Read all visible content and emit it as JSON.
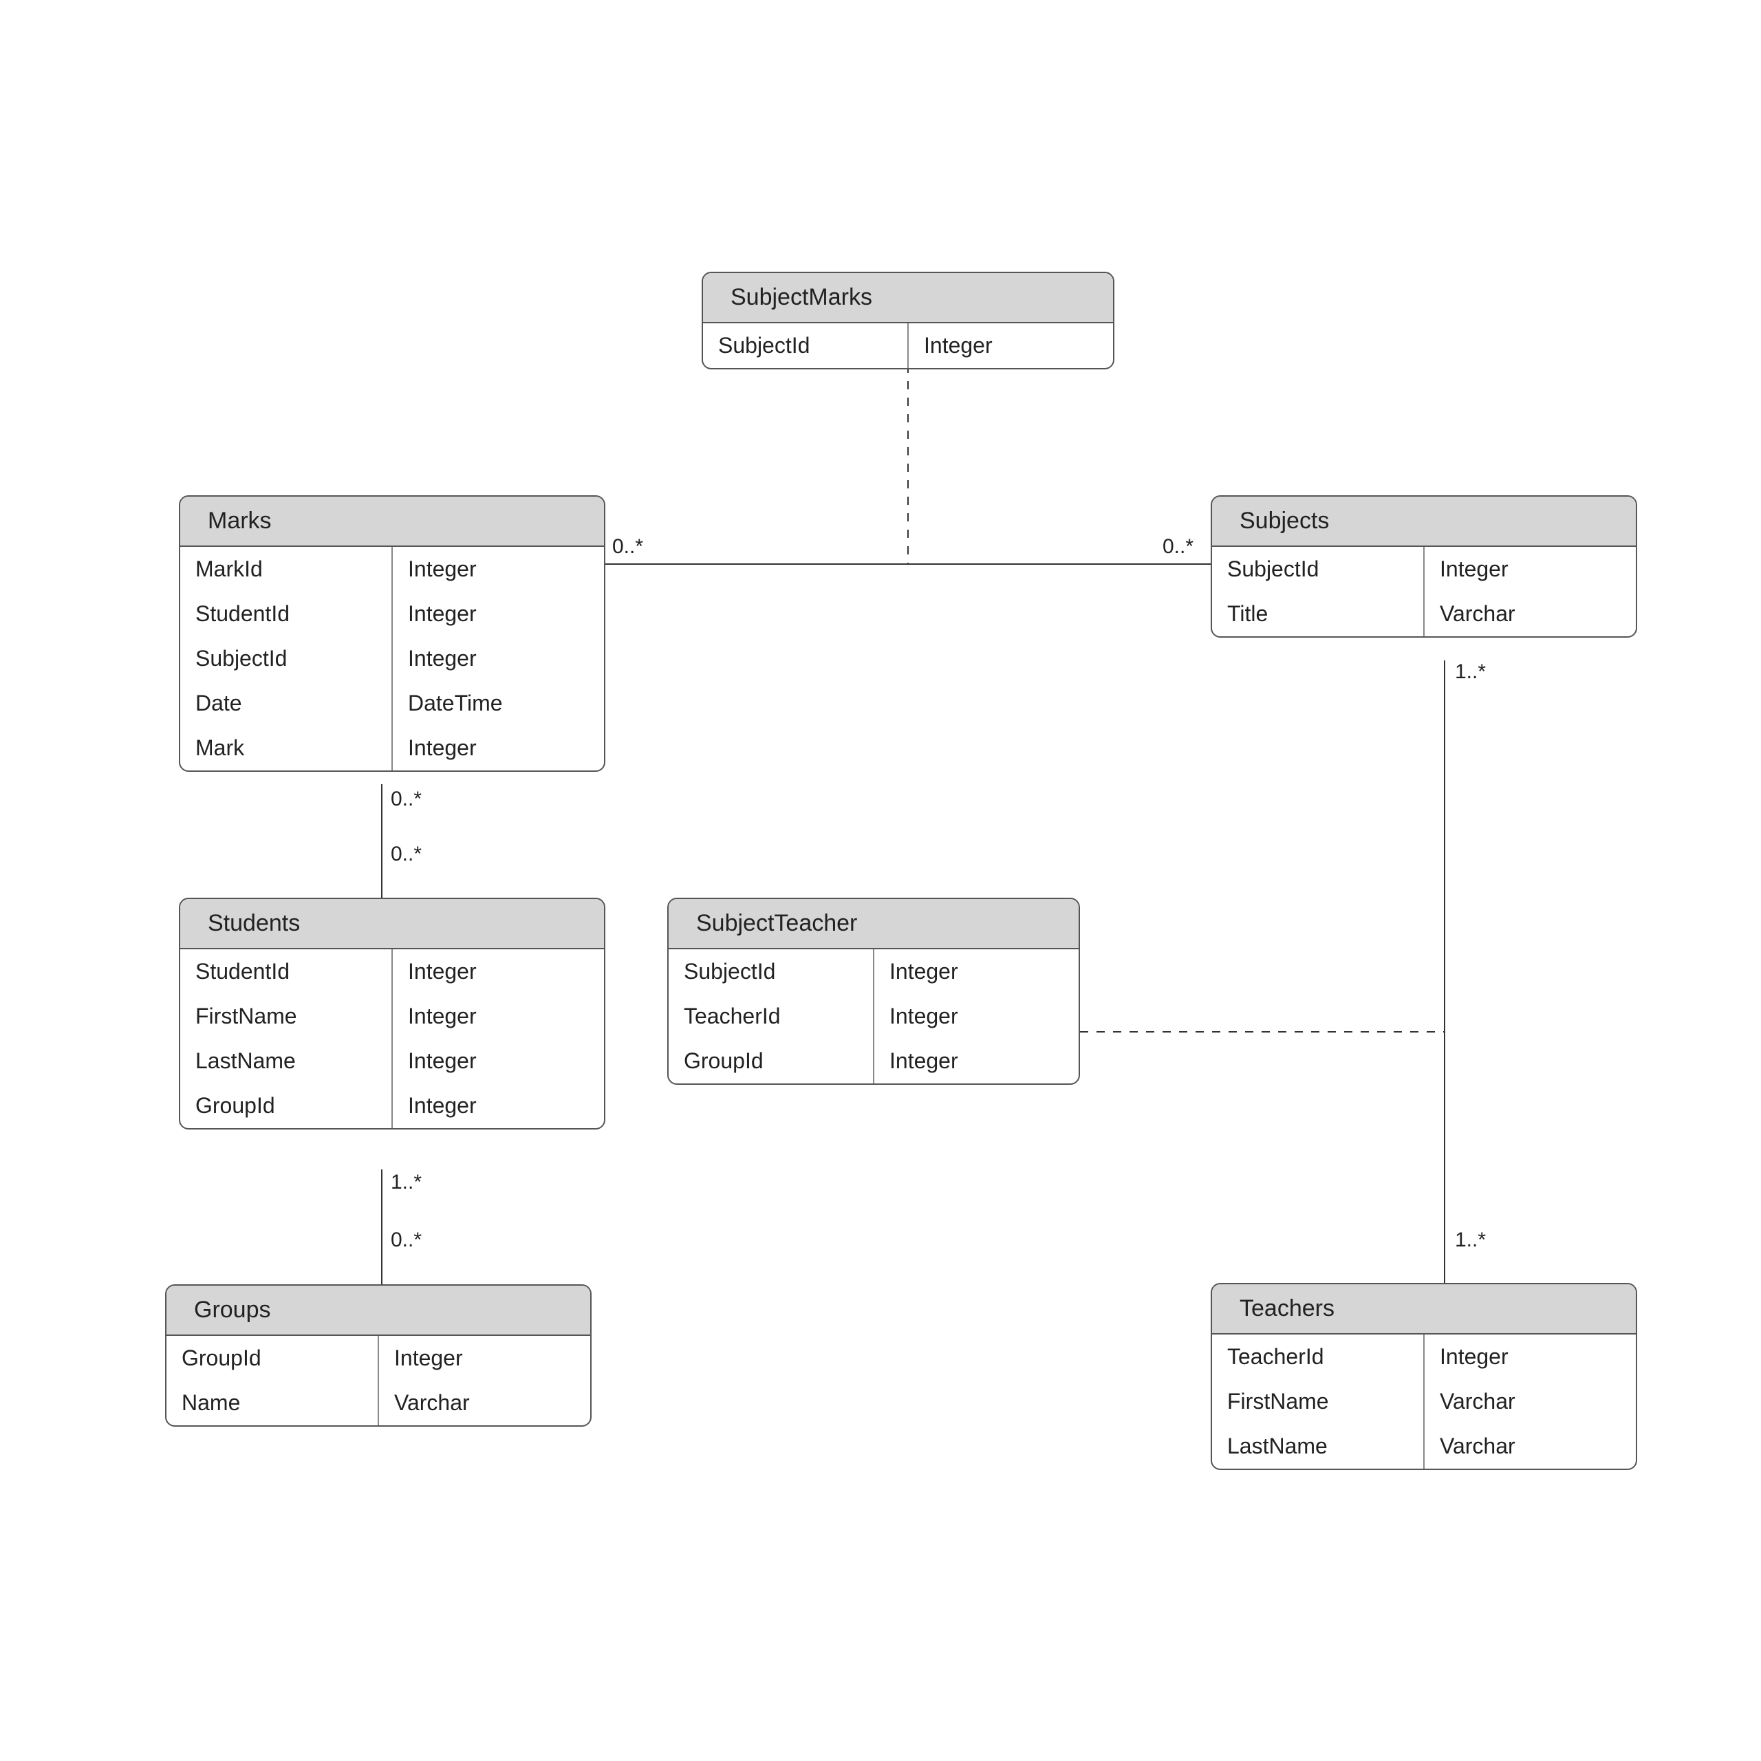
{
  "entities": {
    "subjectMarks": {
      "title": "SubjectMarks",
      "fields": [
        {
          "name": "SubjectId",
          "type": "Integer"
        }
      ]
    },
    "marks": {
      "title": "Marks",
      "fields": [
        {
          "name": "MarkId",
          "type": "Integer"
        },
        {
          "name": "StudentId",
          "type": "Integer"
        },
        {
          "name": "SubjectId",
          "type": "Integer"
        },
        {
          "name": "Date",
          "type": "DateTime"
        },
        {
          "name": "Mark",
          "type": "Integer"
        }
      ]
    },
    "subjects": {
      "title": "Subjects",
      "fields": [
        {
          "name": "SubjectId",
          "type": "Integer"
        },
        {
          "name": "Title",
          "type": "Varchar"
        }
      ]
    },
    "students": {
      "title": "Students",
      "fields": [
        {
          "name": "StudentId",
          "type": "Integer"
        },
        {
          "name": "FirstName",
          "type": "Integer"
        },
        {
          "name": "LastName",
          "type": "Integer"
        },
        {
          "name": "GroupId",
          "type": "Integer"
        }
      ]
    },
    "subjectTeacher": {
      "title": "SubjectTeacher",
      "fields": [
        {
          "name": "SubjectId",
          "type": "Integer"
        },
        {
          "name": "TeacherId",
          "type": "Integer"
        },
        {
          "name": "GroupId",
          "type": "Integer"
        }
      ]
    },
    "groups": {
      "title": "Groups",
      "fields": [
        {
          "name": "GroupId",
          "type": "Integer"
        },
        {
          "name": "Name",
          "type": "Varchar"
        }
      ]
    },
    "teachers": {
      "title": "Teachers",
      "fields": [
        {
          "name": "TeacherId",
          "type": "Integer"
        },
        {
          "name": "FirstName",
          "type": "Varchar"
        },
        {
          "name": "LastName",
          "type": "Varchar"
        }
      ]
    }
  },
  "multiplicities": {
    "marks_subjects_left": "0..*",
    "marks_subjects_right": "0..*",
    "marks_students_top": "0..*",
    "marks_students_bottom": "0..*",
    "students_groups_top": "1..*",
    "students_groups_bottom": "0..*",
    "subjects_teachers_top": "1..*",
    "subjects_teachers_bottom": "1..*"
  }
}
